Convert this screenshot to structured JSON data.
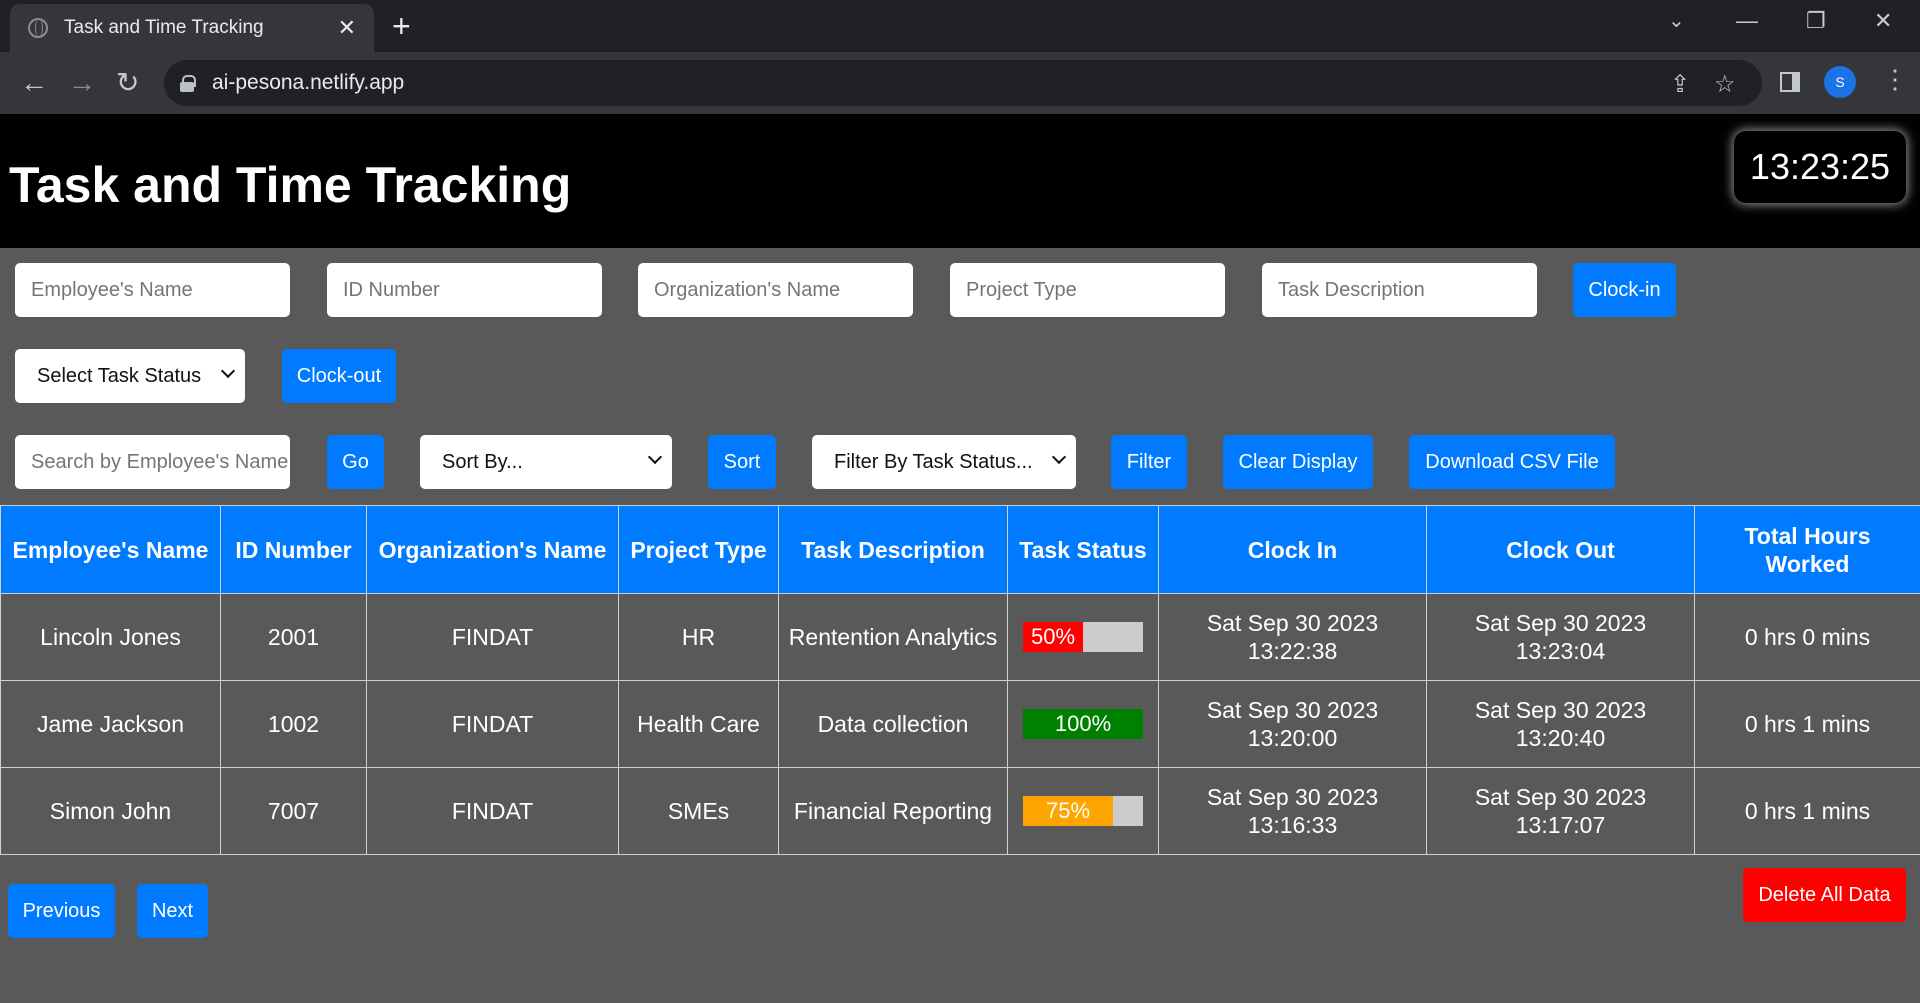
{
  "browser": {
    "tab_title": "Task and Time Tracking",
    "url": "ai-pesona.netlify.app",
    "profile_initial": "S"
  },
  "header": {
    "title": "Task and Time Tracking",
    "clock": "13:23:25"
  },
  "form": {
    "employee_name_placeholder": "Employee's Name",
    "id_number_placeholder": "ID Number",
    "organization_placeholder": "Organization's Name",
    "project_type_placeholder": "Project Type",
    "task_description_placeholder": "Task Description",
    "clock_in_label": "Clock-in",
    "task_status_select": "Select Task Status",
    "clock_out_label": "Clock-out"
  },
  "controls": {
    "search_placeholder": "Search by Employee's Name",
    "go_label": "Go",
    "sort_select": "Sort By...",
    "sort_label": "Sort",
    "filter_select": "Filter By Task Status...",
    "filter_label": "Filter",
    "clear_label": "Clear Display",
    "download_label": "Download CSV File"
  },
  "table": {
    "headers": [
      "Employee's Name",
      "ID Number",
      "Organization's Name",
      "Project Type",
      "Task Description",
      "Task Status",
      "Clock In",
      "Clock Out",
      "Total Hours Worked"
    ],
    "rows": [
      {
        "name": "Lincoln Jones",
        "id": "2001",
        "org": "FINDAT",
        "project": "HR",
        "task": "Rentention Analytics",
        "status_label": "50%",
        "status_percent": 50,
        "status_color": "#ff0000",
        "clock_in_date": "Sat Sep 30 2023",
        "clock_in_time": "13:22:38",
        "clock_out_date": "Sat Sep 30 2023",
        "clock_out_time": "13:23:04",
        "total": "0 hrs 0 mins"
      },
      {
        "name": "Jame Jackson",
        "id": "1002",
        "org": "FINDAT",
        "project": "Health Care",
        "task": "Data collection",
        "status_label": "100%",
        "status_percent": 100,
        "status_color": "#008000",
        "clock_in_date": "Sat Sep 30 2023",
        "clock_in_time": "13:20:00",
        "clock_out_date": "Sat Sep 30 2023",
        "clock_out_time": "13:20:40",
        "total": "0 hrs 1 mins"
      },
      {
        "name": "Simon John",
        "id": "7007",
        "org": "FINDAT",
        "project": "SMEs",
        "task": "Financial Reporting",
        "status_label": "75%",
        "status_percent": 75,
        "status_color": "#ffa500",
        "clock_in_date": "Sat Sep 30 2023",
        "clock_in_time": "13:16:33",
        "clock_out_date": "Sat Sep 30 2023",
        "clock_out_time": "13:17:07",
        "total": "0 hrs 1 mins"
      }
    ]
  },
  "pagination": {
    "previous_label": "Previous",
    "next_label": "Next"
  },
  "delete_all_label": "Delete All Data"
}
